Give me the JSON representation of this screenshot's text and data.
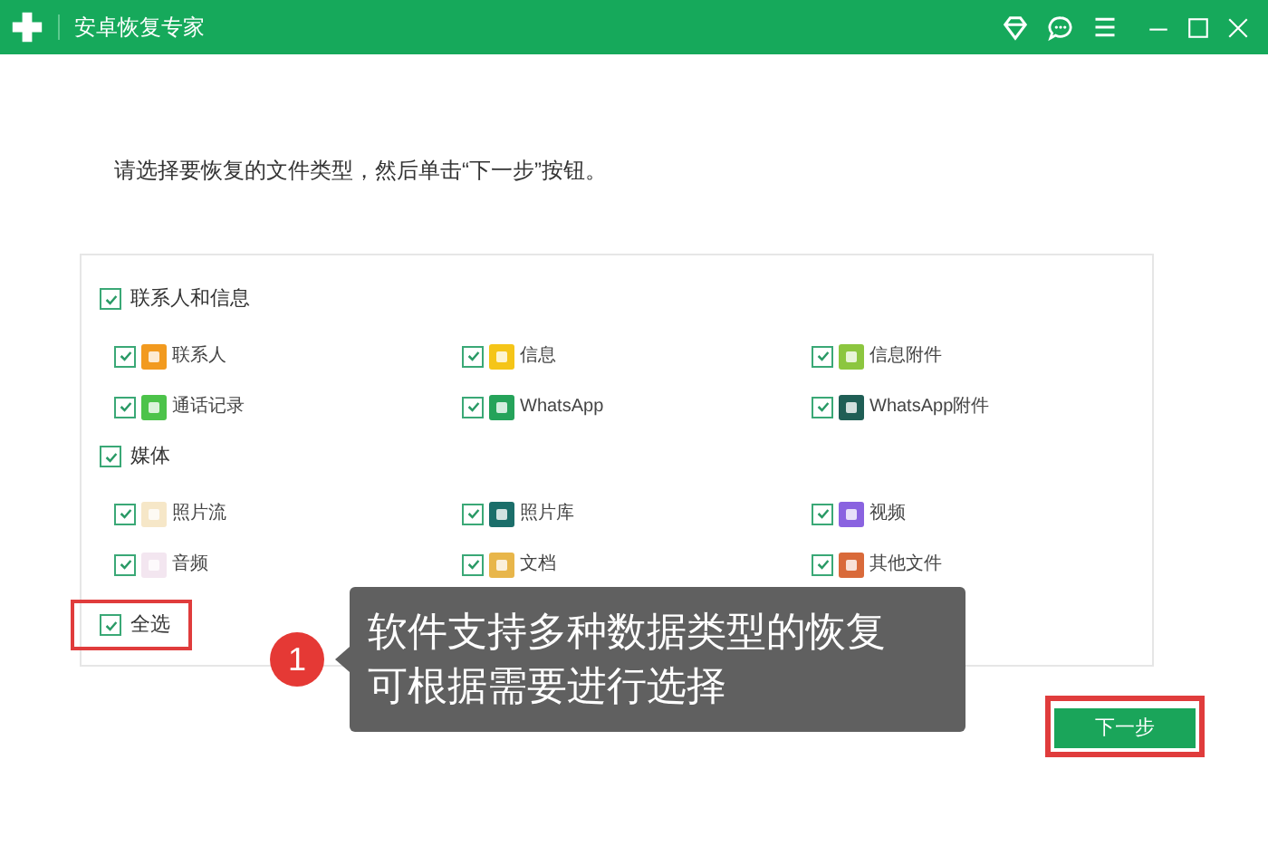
{
  "window": {
    "title": "安卓恢复专家"
  },
  "instruction": "请选择要恢复的文件类型，然后单击“下一步”按钮。",
  "groups": [
    {
      "label": "联系人和信息",
      "checked": true,
      "items": [
        {
          "label": "联系人",
          "checked": true
        },
        {
          "label": "信息",
          "checked": true
        },
        {
          "label": "信息附件",
          "checked": true
        },
        {
          "label": "通话记录",
          "checked": true
        },
        {
          "label": "WhatsApp",
          "checked": true
        },
        {
          "label": "WhatsApp附件",
          "checked": true
        }
      ]
    },
    {
      "label": "媒体",
      "checked": true,
      "items": [
        {
          "label": "照片流",
          "checked": true
        },
        {
          "label": "照片库",
          "checked": true
        },
        {
          "label": "视频",
          "checked": true
        },
        {
          "label": "音频",
          "checked": true
        },
        {
          "label": "文档",
          "checked": true
        },
        {
          "label": "其他文件",
          "checked": true
        }
      ]
    }
  ],
  "select_all": {
    "label": "全选",
    "checked": true
  },
  "next_button": "下一步",
  "callout": {
    "number": "1",
    "lines": [
      "软件支持多种数据类型的恢复",
      "可根据需要进行选择"
    ]
  }
}
